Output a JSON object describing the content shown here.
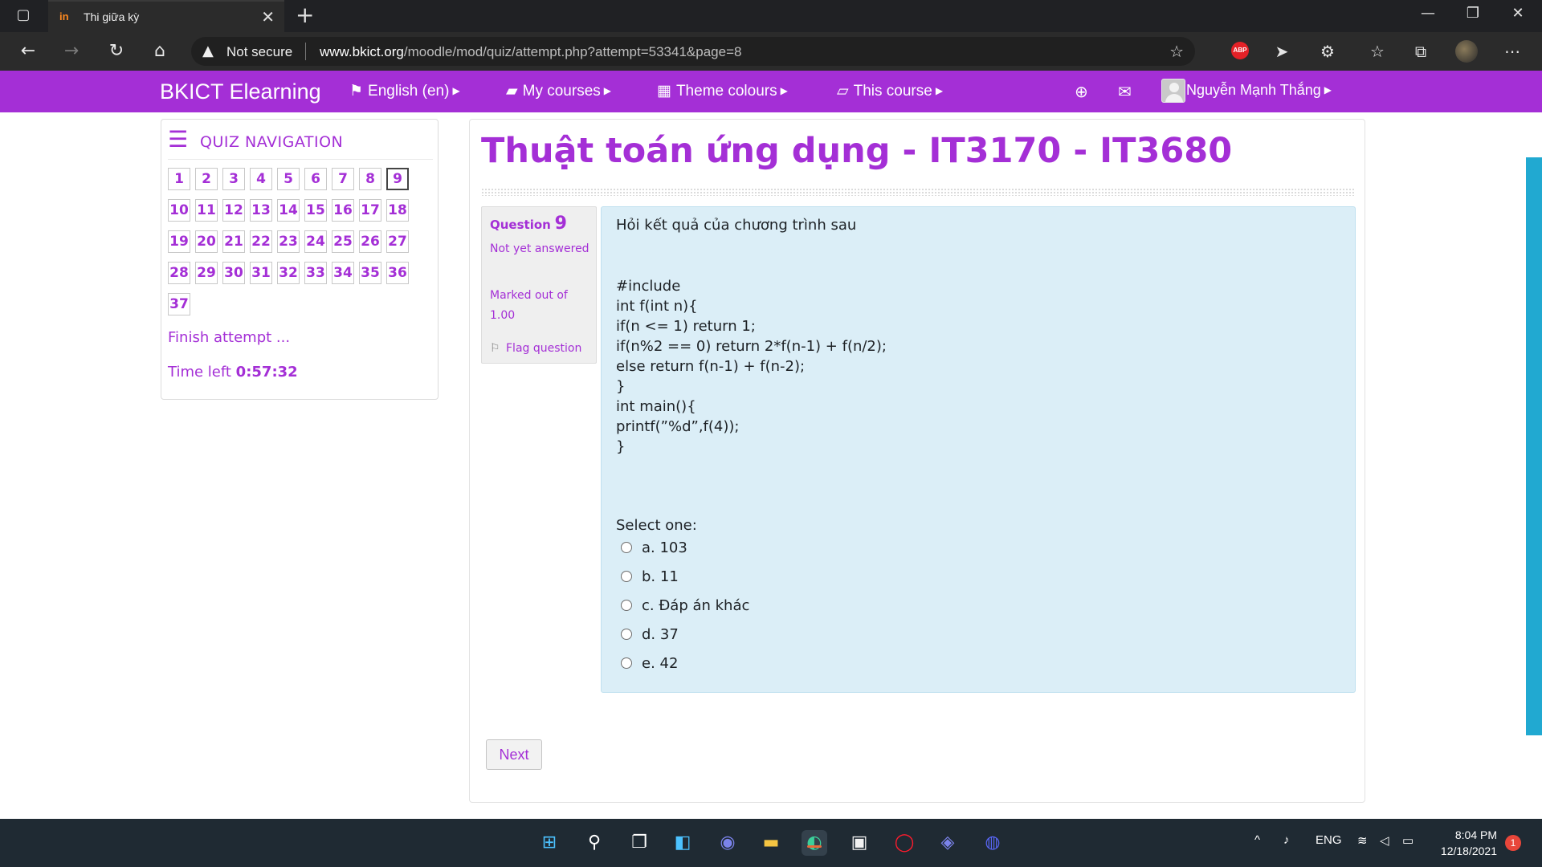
{
  "browser": {
    "tab_title": "Thi giữa kỳ",
    "tab_favicon": "in",
    "security_label": "Not secure",
    "url_host": "www.bkict.org",
    "url_path": "/moodle/mod/quiz/attempt.php?attempt=53341&page=8",
    "icons": [
      "tab-actions-icon",
      "back-icon",
      "forward-icon",
      "refresh-icon",
      "home-icon",
      "warning-icon",
      "favorite-add-icon",
      "adblock-icon",
      "cursor-extension-icon",
      "extensions-icon",
      "favorites-icon",
      "collections-icon",
      "profile-icon",
      "more-icon",
      "minimize-icon",
      "restore-icon",
      "close-icon"
    ],
    "abp_label": "ABP"
  },
  "navbar": {
    "brand": "BKICT Elearning",
    "language": "English (en)",
    "my_courses": "My courses",
    "theme_colours": "Theme colours",
    "this_course": "This course",
    "user_name": "Nguyễn Mạnh Thắng",
    "accent_color": "#a42fd6"
  },
  "quiz_nav": {
    "title": "QUIZ NAVIGATION",
    "questions": [
      "1",
      "2",
      "3",
      "4",
      "5",
      "6",
      "7",
      "8",
      "9",
      "10",
      "11",
      "12",
      "13",
      "14",
      "15",
      "16",
      "17",
      "18",
      "19",
      "20",
      "21",
      "22",
      "23",
      "24",
      "25",
      "26",
      "27",
      "28",
      "29",
      "30",
      "31",
      "32",
      "33",
      "34",
      "35",
      "36",
      "37"
    ],
    "current": "9",
    "finish_label": "Finish attempt ...",
    "time_label": "Time left",
    "time_value": "0:57:32"
  },
  "main": {
    "course_title": "Thuật toán ứng dụng - IT3170 - IT3680"
  },
  "question": {
    "label": "Question",
    "number": "9",
    "state": "Not yet answered",
    "grade": "Marked out of 1.00",
    "flag_label": "Flag question",
    "text": "Hỏi kết quả của chương trình sau",
    "code_lines": [
      "#include",
      "int f(int n){",
      "if(n <= 1) return 1;",
      "if(n%2 == 0) return 2*f(n-1) + f(n/2);",
      "else return f(n-1) + f(n-2);",
      "}",
      "int main(){",
      "printf(”%d”,f(4));",
      "}"
    ],
    "prompt": "Select one:",
    "answers": [
      "a. 103",
      "b. 11",
      "c. Đáp án khác",
      "d. 37",
      "e. 42"
    ],
    "content_bg": "#dbeef7"
  },
  "next_label": "Next",
  "taskbar": {
    "tray_lang": "ENG",
    "time": "8:04 PM",
    "date": "12/18/2021",
    "notification_count": "1",
    "icons": [
      "windows-start-icon",
      "search-icon",
      "task-view-icon",
      "widgets-icon",
      "teams-chat-icon",
      "file-explorer-icon",
      "edge-icon",
      "store-icon",
      "opera-icon",
      "teams-icon",
      "discord-icon"
    ]
  }
}
